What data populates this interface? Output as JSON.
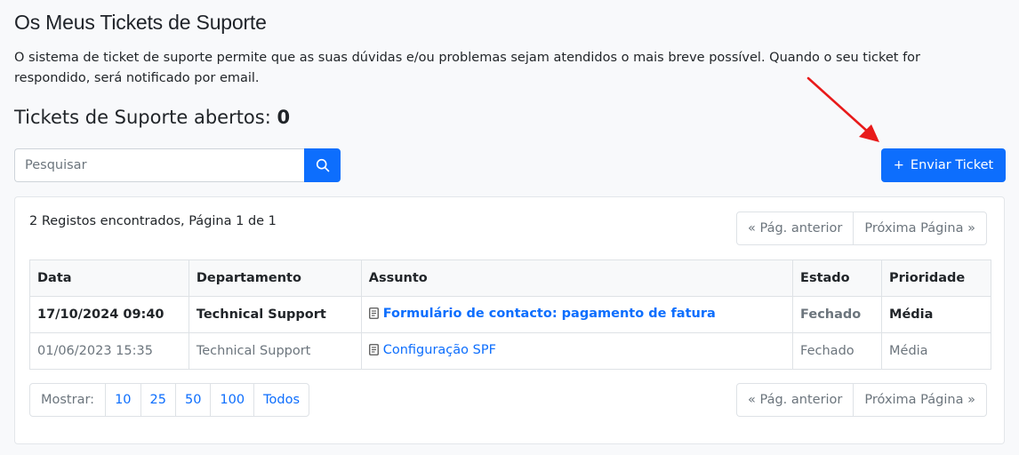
{
  "page": {
    "title": "Os Meus Tickets de Suporte",
    "intro": "O sistema de ticket de suporte permite que as suas dúvidas e/ou problemas sejam atendidos o mais breve possível. Quando o seu ticket for respondido, será notificado por email.",
    "open_label": "Tickets de Suporte abertos:",
    "open_count": "0"
  },
  "search": {
    "placeholder": "Pesquisar",
    "icon": "search-icon"
  },
  "send_button": {
    "icon": "+",
    "label": "Enviar Ticket"
  },
  "records_text": "2 Registos encontrados, Página 1 de 1",
  "pagination": {
    "prev": "« Pág. anterior",
    "next": "Próxima Página »"
  },
  "table": {
    "headers": [
      "Data",
      "Departamento",
      "Assunto",
      "Estado",
      "Prioridade"
    ],
    "rows": [
      {
        "date": "17/10/2024 09:40",
        "department": "Technical Support",
        "subject": "Formulário de contacto: pagamento de fatura",
        "status": "Fechado",
        "priority": "Média"
      },
      {
        "date": "01/06/2023 15:35",
        "department": "Technical Support",
        "subject": "Configuração SPF",
        "status": "Fechado",
        "priority": "Média"
      }
    ]
  },
  "show": {
    "label": "Mostrar:",
    "options": [
      "10",
      "25",
      "50",
      "100",
      "Todos"
    ]
  },
  "colors": {
    "primary": "#0d6efd",
    "arrow": "#e81a1a",
    "muted": "#6c757d"
  }
}
